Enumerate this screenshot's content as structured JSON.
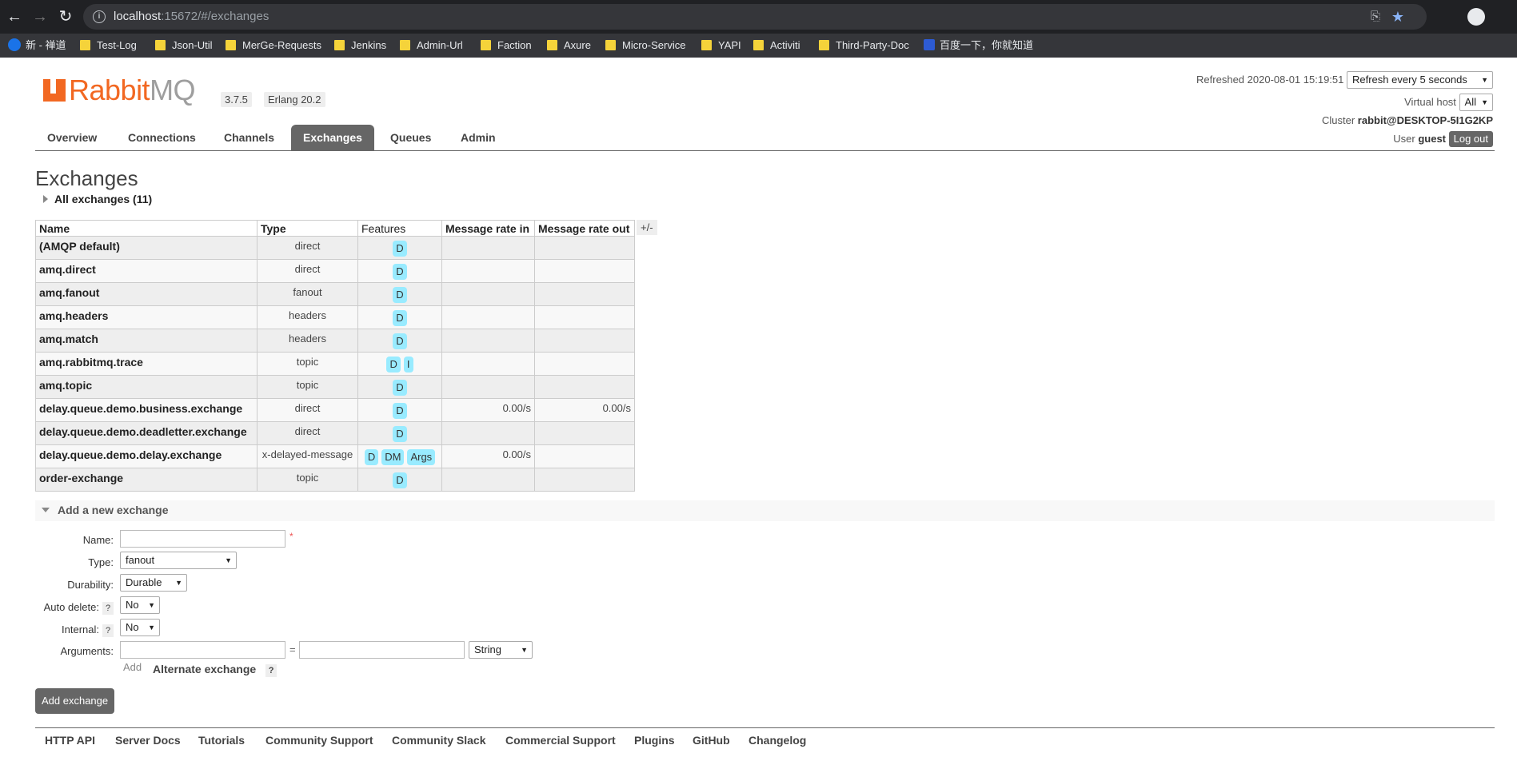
{
  "browser": {
    "url_host": "localhost",
    "url_path": ":15672/#/exchanges",
    "bookmarks": [
      {
        "label": "新 - 禅道",
        "icon": "zentao-icon"
      },
      {
        "label": "Test-Log",
        "icon": "folder-icon"
      },
      {
        "label": "Json-Util",
        "icon": "folder-icon"
      },
      {
        "label": "MerGe-Requests",
        "icon": "folder-icon"
      },
      {
        "label": "Jenkins",
        "icon": "folder-icon"
      },
      {
        "label": "Admin-Url",
        "icon": "folder-icon"
      },
      {
        "label": "Faction",
        "icon": "folder-icon"
      },
      {
        "label": "Axure",
        "icon": "folder-icon"
      },
      {
        "label": "Micro-Service",
        "icon": "folder-icon"
      },
      {
        "label": "YAPI",
        "icon": "folder-icon"
      },
      {
        "label": "Activiti",
        "icon": "folder-icon"
      },
      {
        "label": "Third-Party-Doc",
        "icon": "folder-icon"
      },
      {
        "label": "百度一下，你就知道",
        "icon": "baidu-icon"
      }
    ]
  },
  "header": {
    "logo_rabbit": "RabbitMQ",
    "version": "3.7.5",
    "erlang": "Erlang 20.2",
    "refreshed_label": "Refreshed",
    "refreshed_time": "2020-08-01 15:19:51",
    "refresh_option": "Refresh every 5 seconds",
    "vhost_label": "Virtual host",
    "vhost_value": "All",
    "cluster_label": "Cluster",
    "cluster_value": "rabbit@DESKTOP-5I1G2KP",
    "user_label": "User",
    "user_value": "guest",
    "logout_label": "Log out"
  },
  "tabs": [
    "Overview",
    "Connections",
    "Channels",
    "Exchanges",
    "Queues",
    "Admin"
  ],
  "active_tab": "Exchanges",
  "page": {
    "title": "Exchanges",
    "all_exchanges": "All exchanges (11)",
    "plus_minus": "+/-"
  },
  "table": {
    "headers": [
      "Name",
      "Type",
      "Features",
      "Message rate in",
      "Message rate out"
    ],
    "rows": [
      {
        "name": "(AMQP default)",
        "type": "direct",
        "features": [
          "D"
        ],
        "rate_in": "",
        "rate_out": ""
      },
      {
        "name": "amq.direct",
        "type": "direct",
        "features": [
          "D"
        ],
        "rate_in": "",
        "rate_out": ""
      },
      {
        "name": "amq.fanout",
        "type": "fanout",
        "features": [
          "D"
        ],
        "rate_in": "",
        "rate_out": ""
      },
      {
        "name": "amq.headers",
        "type": "headers",
        "features": [
          "D"
        ],
        "rate_in": "",
        "rate_out": ""
      },
      {
        "name": "amq.match",
        "type": "headers",
        "features": [
          "D"
        ],
        "rate_in": "",
        "rate_out": ""
      },
      {
        "name": "amq.rabbitmq.trace",
        "type": "topic",
        "features": [
          "D",
          "I"
        ],
        "rate_in": "",
        "rate_out": ""
      },
      {
        "name": "amq.topic",
        "type": "topic",
        "features": [
          "D"
        ],
        "rate_in": "",
        "rate_out": ""
      },
      {
        "name": "delay.queue.demo.business.exchange",
        "type": "direct",
        "features": [
          "D"
        ],
        "rate_in": "0.00/s",
        "rate_out": "0.00/s"
      },
      {
        "name": "delay.queue.demo.deadletter.exchange",
        "type": "direct",
        "features": [
          "D"
        ],
        "rate_in": "",
        "rate_out": ""
      },
      {
        "name": "delay.queue.demo.delay.exchange",
        "type": "x-delayed-message",
        "features": [
          "D",
          "DM",
          "Args"
        ],
        "rate_in": "0.00/s",
        "rate_out": ""
      },
      {
        "name": "order-exchange",
        "type": "topic",
        "features": [
          "D"
        ],
        "rate_in": "",
        "rate_out": ""
      }
    ]
  },
  "add_form": {
    "section_title": "Add a new exchange",
    "name_label": "Name:",
    "name_value": "",
    "required_mark": "*",
    "type_label": "Type:",
    "type_value": "fanout",
    "durability_label": "Durability:",
    "durability_value": "Durable",
    "auto_delete_label": "Auto delete:",
    "auto_delete_value": "No",
    "internal_label": "Internal:",
    "internal_value": "No",
    "arguments_label": "Arguments:",
    "arg_key": "",
    "arg_equals": "=",
    "arg_value": "",
    "arg_type": "String",
    "help_mark": "?",
    "add_link": "Add",
    "alternate_exchange": "Alternate exchange",
    "submit_label": "Add exchange"
  },
  "footer": [
    "HTTP API",
    "Server Docs",
    "Tutorials",
    "Community Support",
    "Community Slack",
    "Commercial Support",
    "Plugins",
    "GitHub",
    "Changelog"
  ]
}
